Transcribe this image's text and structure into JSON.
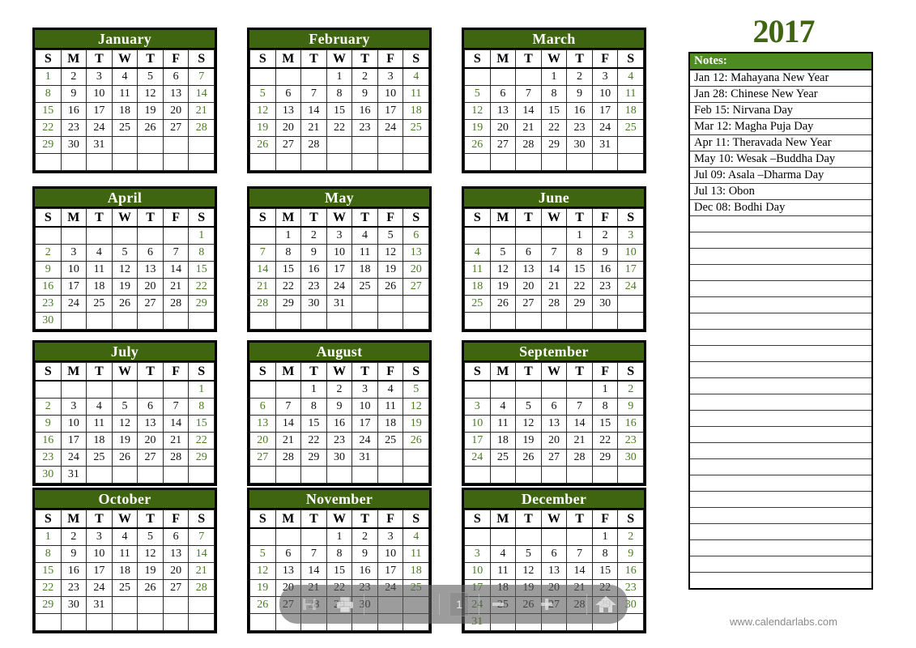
{
  "document": {
    "year_heading": "2017",
    "footer": "www.calendarlabs.com"
  },
  "weekday_headers": [
    "S",
    "M",
    "T",
    "W",
    "T",
    "F",
    "S"
  ],
  "months": [
    {
      "name": "January",
      "weeks": [
        [
          "1",
          "2",
          "3",
          "4",
          "5",
          "6",
          "7"
        ],
        [
          "8",
          "9",
          "10",
          "11",
          "12",
          "13",
          "14"
        ],
        [
          "15",
          "16",
          "17",
          "18",
          "19",
          "20",
          "21"
        ],
        [
          "22",
          "23",
          "24",
          "25",
          "26",
          "27",
          "28"
        ],
        [
          "29",
          "30",
          "31",
          "",
          "",
          "",
          ""
        ],
        [
          "",
          "",
          "",
          "",
          "",
          "",
          ""
        ]
      ]
    },
    {
      "name": "February",
      "weeks": [
        [
          "",
          "",
          "",
          "1",
          "2",
          "3",
          "4"
        ],
        [
          "5",
          "6",
          "7",
          "8",
          "9",
          "10",
          "11"
        ],
        [
          "12",
          "13",
          "14",
          "15",
          "16",
          "17",
          "18"
        ],
        [
          "19",
          "20",
          "21",
          "22",
          "23",
          "24",
          "25"
        ],
        [
          "26",
          "27",
          "28",
          "",
          "",
          "",
          ""
        ],
        [
          "",
          "",
          "",
          "",
          "",
          "",
          ""
        ]
      ]
    },
    {
      "name": "March",
      "weeks": [
        [
          "",
          "",
          "",
          "1",
          "2",
          "3",
          "4"
        ],
        [
          "5",
          "6",
          "7",
          "8",
          "9",
          "10",
          "11"
        ],
        [
          "12",
          "13",
          "14",
          "15",
          "16",
          "17",
          "18"
        ],
        [
          "19",
          "20",
          "21",
          "22",
          "23",
          "24",
          "25"
        ],
        [
          "26",
          "27",
          "28",
          "29",
          "30",
          "31",
          ""
        ],
        [
          "",
          "",
          "",
          "",
          "",
          "",
          ""
        ]
      ]
    },
    {
      "name": "April",
      "weeks": [
        [
          "",
          "",
          "",
          "",
          "",
          "",
          "1"
        ],
        [
          "2",
          "3",
          "4",
          "5",
          "6",
          "7",
          "8"
        ],
        [
          "9",
          "10",
          "11",
          "12",
          "13",
          "14",
          "15"
        ],
        [
          "16",
          "17",
          "18",
          "19",
          "20",
          "21",
          "22"
        ],
        [
          "23",
          "24",
          "25",
          "26",
          "27",
          "28",
          "29"
        ],
        [
          "30",
          "",
          "",
          "",
          "",
          "",
          ""
        ]
      ]
    },
    {
      "name": "May",
      "weeks": [
        [
          "",
          "1",
          "2",
          "3",
          "4",
          "5",
          "6"
        ],
        [
          "7",
          "8",
          "9",
          "10",
          "11",
          "12",
          "13"
        ],
        [
          "14",
          "15",
          "16",
          "17",
          "18",
          "19",
          "20"
        ],
        [
          "21",
          "22",
          "23",
          "24",
          "25",
          "26",
          "27"
        ],
        [
          "28",
          "29",
          "30",
          "31",
          "",
          "",
          ""
        ],
        [
          "",
          "",
          "",
          "",
          "",
          "",
          ""
        ]
      ]
    },
    {
      "name": "June",
      "weeks": [
        [
          "",
          "",
          "",
          "",
          "1",
          "2",
          "3"
        ],
        [
          "4",
          "5",
          "6",
          "7",
          "8",
          "9",
          "10"
        ],
        [
          "11",
          "12",
          "13",
          "14",
          "15",
          "16",
          "17"
        ],
        [
          "18",
          "19",
          "20",
          "21",
          "22",
          "23",
          "24"
        ],
        [
          "25",
          "26",
          "27",
          "28",
          "29",
          "30",
          ""
        ],
        [
          "",
          "",
          "",
          "",
          "",
          "",
          ""
        ]
      ]
    },
    {
      "name": "July",
      "weeks": [
        [
          "",
          "",
          "",
          "",
          "",
          "",
          "1"
        ],
        [
          "2",
          "3",
          "4",
          "5",
          "6",
          "7",
          "8"
        ],
        [
          "9",
          "10",
          "11",
          "12",
          "13",
          "14",
          "15"
        ],
        [
          "16",
          "17",
          "18",
          "19",
          "20",
          "21",
          "22"
        ],
        [
          "23",
          "24",
          "25",
          "26",
          "27",
          "28",
          "29"
        ],
        [
          "30",
          "31",
          "",
          "",
          "",
          "",
          ""
        ]
      ]
    },
    {
      "name": "August",
      "weeks": [
        [
          "",
          "",
          "1",
          "2",
          "3",
          "4",
          "5"
        ],
        [
          "6",
          "7",
          "8",
          "9",
          "10",
          "11",
          "12"
        ],
        [
          "13",
          "14",
          "15",
          "16",
          "17",
          "18",
          "19"
        ],
        [
          "20",
          "21",
          "22",
          "23",
          "24",
          "25",
          "26"
        ],
        [
          "27",
          "28",
          "29",
          "30",
          "31",
          "",
          ""
        ],
        [
          "",
          "",
          "",
          "",
          "",
          "",
          ""
        ]
      ]
    },
    {
      "name": "September",
      "weeks": [
        [
          "",
          "",
          "",
          "",
          "",
          "1",
          "2"
        ],
        [
          "3",
          "4",
          "5",
          "6",
          "7",
          "8",
          "9"
        ],
        [
          "10",
          "11",
          "12",
          "13",
          "14",
          "15",
          "16"
        ],
        [
          "17",
          "18",
          "19",
          "20",
          "21",
          "22",
          "23"
        ],
        [
          "24",
          "25",
          "26",
          "27",
          "28",
          "29",
          "30"
        ],
        [
          "",
          "",
          "",
          "",
          "",
          "",
          ""
        ]
      ]
    },
    {
      "name": "October",
      "weeks": [
        [
          "1",
          "2",
          "3",
          "4",
          "5",
          "6",
          "7"
        ],
        [
          "8",
          "9",
          "10",
          "11",
          "12",
          "13",
          "14"
        ],
        [
          "15",
          "16",
          "17",
          "18",
          "19",
          "20",
          "21"
        ],
        [
          "22",
          "23",
          "24",
          "25",
          "26",
          "27",
          "28"
        ],
        [
          "29",
          "30",
          "31",
          "",
          "",
          "",
          ""
        ],
        [
          "",
          "",
          "",
          "",
          "",
          "",
          ""
        ]
      ]
    },
    {
      "name": "November",
      "weeks": [
        [
          "",
          "",
          "",
          "1",
          "2",
          "3",
          "4"
        ],
        [
          "5",
          "6",
          "7",
          "8",
          "9",
          "10",
          "11"
        ],
        [
          "12",
          "13",
          "14",
          "15",
          "16",
          "17",
          "18"
        ],
        [
          "19",
          "20",
          "21",
          "22",
          "23",
          "24",
          "25"
        ],
        [
          "26",
          "27",
          "28",
          "29",
          "30",
          "",
          ""
        ],
        [
          "",
          "",
          "",
          "",
          "",
          "",
          ""
        ]
      ]
    },
    {
      "name": "December",
      "weeks": [
        [
          "",
          "",
          "",
          "",
          "",
          "1",
          "2"
        ],
        [
          "3",
          "4",
          "5",
          "6",
          "7",
          "8",
          "9"
        ],
        [
          "10",
          "11",
          "12",
          "13",
          "14",
          "15",
          "16"
        ],
        [
          "17",
          "18",
          "19",
          "20",
          "21",
          "22",
          "23"
        ],
        [
          "24",
          "25",
          "26",
          "27",
          "28",
          "29",
          "30"
        ],
        [
          "31",
          "",
          "",
          "",
          "",
          "",
          ""
        ]
      ]
    }
  ],
  "notes": {
    "title": "Notes:",
    "entries": [
      "Jan 12: Mahayana New Year",
      "Jan 28: Chinese New Year",
      "Feb 15: Nirvana Day",
      "Mar 12: Magha Puja Day",
      "Apr 11: Theravada New Year",
      "May 10: Wesak –Buddha Day",
      "Jul 09: Asala –Dharma Day",
      "Jul 13: Obon",
      "Dec 08: Bodhi Day"
    ],
    "blank_line_count": 23
  },
  "toolbar": {
    "page_number": "1",
    "icons": [
      "save-icon",
      "print-icon",
      "zoom-out-icon",
      "zoom-in-icon",
      "home-icon"
    ]
  },
  "colors": {
    "month_header_green": "#3f6511",
    "notes_header_green": "#4e8b22",
    "weekend_text_green": "#4a7a21",
    "year_green": "#3f6511"
  }
}
